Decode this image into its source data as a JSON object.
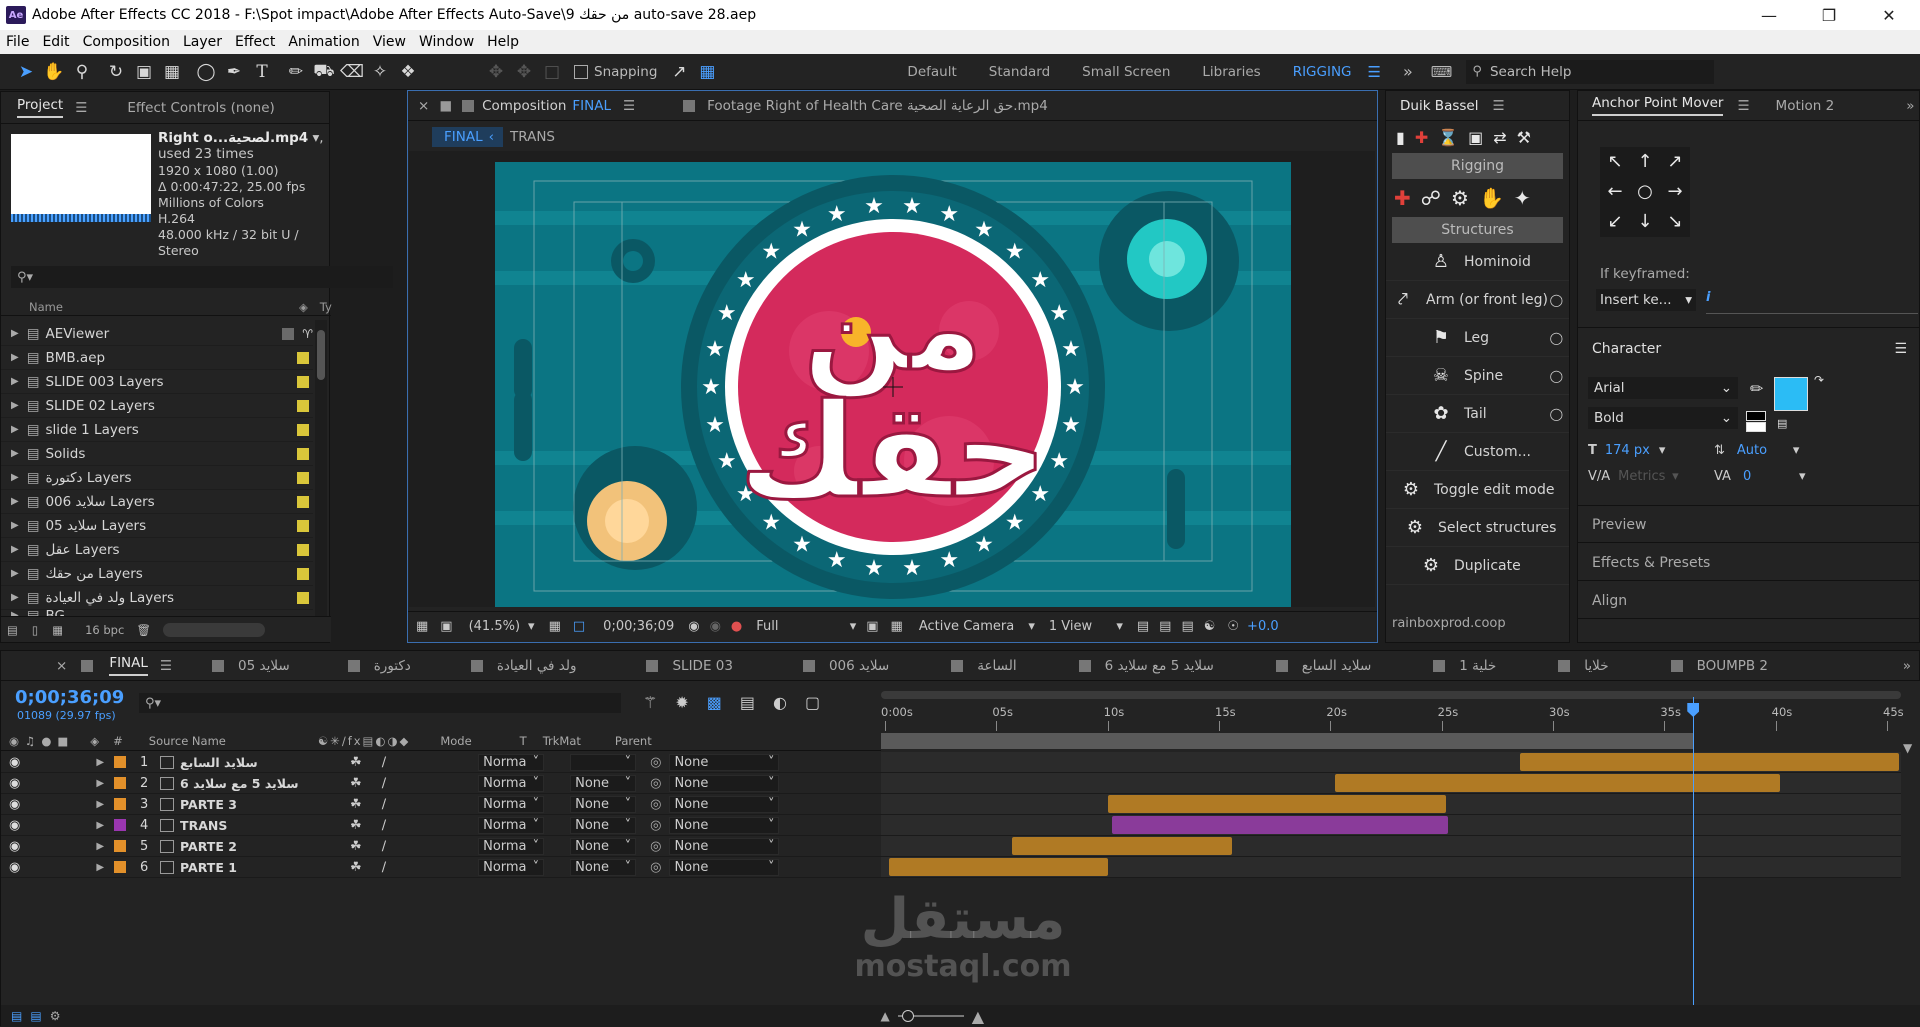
{
  "titlebar": {
    "app_icon": "Ae",
    "title": "Adobe After Effects CC 2018 - F:\\Spot impact\\Adobe After Effects Auto-Save\\9 من حقك auto-save 28.aep"
  },
  "menu": [
    "File",
    "Edit",
    "Composition",
    "Layer",
    "Effect",
    "Animation",
    "View",
    "Window",
    "Help"
  ],
  "toolbar": {
    "snapping": "Snapping",
    "workspaces": [
      "Default",
      "Standard",
      "Small Screen",
      "Libraries"
    ],
    "active_workspace": "RIGGING",
    "search_placeholder": "Search Help"
  },
  "project_panel": {
    "tab_project": "Project",
    "tab_effect_controls": "Effect Controls (none)",
    "footage_name": "Right o...لصحية.mp4",
    "footage_used": ", used 23 times",
    "footage_info": [
      "1920 x 1080 (1.00)",
      "Δ 0:00:47:22, 25.00 fps",
      "Millions of Colors",
      "H.264",
      "48.000 kHz / 32 bit U / Stereo"
    ],
    "col_name": "Name",
    "col_type": "Ty",
    "items": [
      {
        "name": "AEViewer",
        "type": "folder"
      },
      {
        "name": "BMB.aep",
        "type": "folder"
      },
      {
        "name": "SLIDE 003 Layers",
        "type": "folder"
      },
      {
        "name": "SLIDE 02 Layers",
        "type": "folder"
      },
      {
        "name": "slide 1 Layers",
        "type": "folder"
      },
      {
        "name": "Solids",
        "type": "folder"
      },
      {
        "name": "دكتورة Layers",
        "type": "folder"
      },
      {
        "name": "006 سلايد Layers",
        "type": "folder"
      },
      {
        "name": "05 سلايد Layers",
        "type": "folder"
      },
      {
        "name": "عقل Layers",
        "type": "folder"
      },
      {
        "name": "من حقك Layers",
        "type": "folder"
      },
      {
        "name": "ولد في العيادة Layers",
        "type": "folder"
      },
      {
        "name": "BG",
        "type": "folder"
      }
    ],
    "bpc": "16 bpc"
  },
  "comp_panel": {
    "tab_prefix": "Composition",
    "comp_name": "FINAL",
    "footage_tab": "Footage Right of Health Care حق الرعاية الصحية.mp4",
    "breadcrumb": [
      "FINAL",
      "TRANS"
    ],
    "zoom": "(41.5%)",
    "timecode": "0;00;36;09",
    "resolution": "Full",
    "camera": "Active Camera",
    "views": "1 View",
    "exposure": "+0.0",
    "logo_text_top": "من",
    "logo_text_bottom": "حقك"
  },
  "duik_panel": {
    "tab": "Duik Bassel",
    "section_rigging": "Rigging",
    "section_structures": "Structures",
    "items": [
      "Hominoid",
      "Arm (or front leg)",
      "Leg",
      "Spine",
      "Tail",
      "Custom...",
      "Toggle edit mode",
      "Select structures",
      "Duplicate"
    ],
    "footer": "rainboxprod.coop"
  },
  "anchor_panel": {
    "tab": "Anchor Point Mover",
    "tab2": "Motion 2",
    "if_keyframed": "If keyframed:",
    "insert_value": "Insert ke..."
  },
  "character_panel": {
    "title": "Character",
    "font": "Arial",
    "style": "Bold",
    "size": "174 px",
    "leading": "Auto",
    "kerning": "Metrics",
    "tracking": "0",
    "fill_color": "#2bbcf5"
  },
  "collapsed_panels": [
    "Preview",
    "Effects & Presets",
    "Align"
  ],
  "timeline": {
    "tabs": [
      "FINAL",
      "سلايد 05",
      "دكتورة",
      "ولد في العيادة",
      "SLIDE 03",
      "سلايد 006",
      "الساعة",
      "سلايد 5 مع سلايد 6",
      "سلايد السابع",
      "خلية 1",
      "خلايا",
      "BOUMPB 2"
    ],
    "timecode": "0;00;36;09",
    "frames": "01089 (29.97 fps)",
    "columns": {
      "source": "Source Name",
      "mode": "Mode",
      "t": "T",
      "trkmat": "TrkMat",
      "parent": "Parent"
    },
    "ruler": [
      "0:00s",
      "05s",
      "10s",
      "15s",
      "20s",
      "25s",
      "30s",
      "35s",
      "40s",
      "45s"
    ],
    "duration_s": 46,
    "playhead_s": 36.3,
    "layers": [
      {
        "num": "1",
        "name": "سلايد السابع",
        "color": "#e2902a",
        "mode": "Norma",
        "trkmat": "",
        "parent": "None",
        "start": 28.5,
        "end": 46,
        "bar": "#b07a24"
      },
      {
        "num": "2",
        "name": "سلايد 5 مع سلايد 6",
        "color": "#e2902a",
        "mode": "Norma",
        "trkmat": "None",
        "parent": "None",
        "start": 20.2,
        "end": 40.2,
        "bar": "#b07a24"
      },
      {
        "num": "3",
        "name": "PARTE 3",
        "color": "#e2902a",
        "mode": "Norma",
        "trkmat": "None",
        "parent": "None",
        "start": 10.0,
        "end": 25.2,
        "bar": "#b07a24"
      },
      {
        "num": "4",
        "name": "TRANS",
        "color": "#9a36b0",
        "mode": "Norma",
        "trkmat": "None",
        "parent": "None",
        "start": 10.2,
        "end": 25.3,
        "bar": "#8a3b9a"
      },
      {
        "num": "5",
        "name": "PARTE 2",
        "color": "#e2902a",
        "mode": "Norma",
        "trkmat": "None",
        "parent": "None",
        "start": 5.7,
        "end": 15.6,
        "bar": "#b07a24"
      },
      {
        "num": "6",
        "name": "PARTE 1",
        "color": "#e2902a",
        "mode": "Norma",
        "trkmat": "None",
        "parent": "None",
        "start": 0.2,
        "end": 10.0,
        "bar": "#b07a24"
      }
    ]
  },
  "watermark": {
    "arabic": "مستقل",
    "latin": "mostaql.com"
  }
}
